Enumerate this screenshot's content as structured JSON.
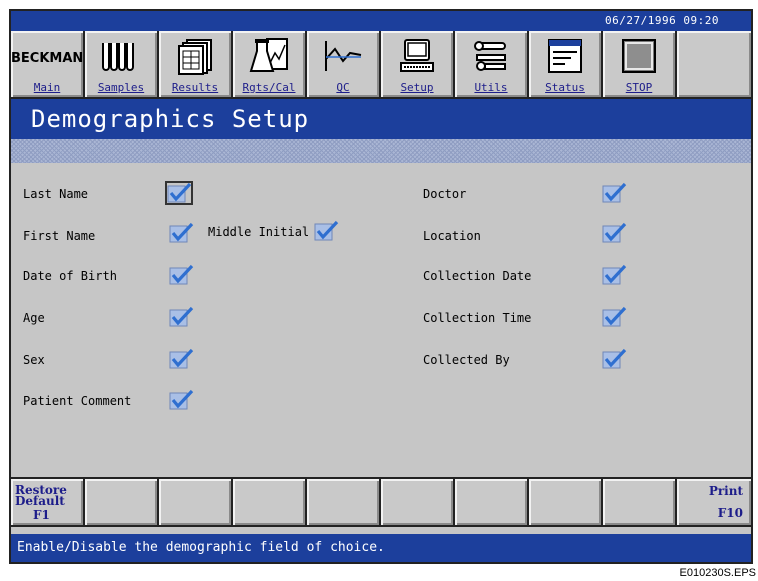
{
  "header": {
    "datetime": "06/27/1996 09:20"
  },
  "toolbar": {
    "brand": "BECKMAN",
    "buttons": [
      {
        "label": "Main",
        "icon": "beckman-logo"
      },
      {
        "label": "Samples",
        "icon": "test-tubes-icon"
      },
      {
        "label": "Results",
        "icon": "report-pages-icon"
      },
      {
        "label": "Rgts/Cal",
        "icon": "flask-icon"
      },
      {
        "label": "QC",
        "icon": "qc-graph-icon"
      },
      {
        "label": "Setup",
        "icon": "computer-icon"
      },
      {
        "label": "Utils",
        "icon": "tools-icon"
      },
      {
        "label": "Status",
        "icon": "status-bars-icon"
      },
      {
        "label": "STOP",
        "icon": "stop-button-icon"
      },
      {
        "label": "",
        "icon": ""
      }
    ]
  },
  "page": {
    "title": "Demographics Setup"
  },
  "fields_left": [
    {
      "label": "Last Name",
      "checked": true,
      "focused": true
    },
    {
      "label": "First Name",
      "checked": true
    },
    {
      "label": "Date of Birth",
      "checked": true
    },
    {
      "label": "Age",
      "checked": true
    },
    {
      "label": "Sex",
      "checked": true
    },
    {
      "label": "Patient Comment",
      "checked": true
    }
  ],
  "middle_initial": {
    "label": "Middle Initial",
    "checked": true
  },
  "fields_right": [
    {
      "label": "Doctor",
      "checked": true
    },
    {
      "label": "Location",
      "checked": true
    },
    {
      "label": "Collection Date",
      "checked": true
    },
    {
      "label": "Collection Time",
      "checked": true
    },
    {
      "label": "Collected By",
      "checked": true
    }
  ],
  "fkeys": {
    "f1": {
      "line1": "Restore",
      "line2": "Default",
      "key": "F1"
    },
    "f10": {
      "line1": "Print",
      "key": "F10"
    }
  },
  "status": {
    "text": "Enable/Disable the demographic field of choice."
  },
  "figure_code": "E010230S.EPS",
  "colors": {
    "accent_blue": "#1c3f9c",
    "panel_gray": "#c6c6c6",
    "check_blue": "#2f6fd0"
  }
}
